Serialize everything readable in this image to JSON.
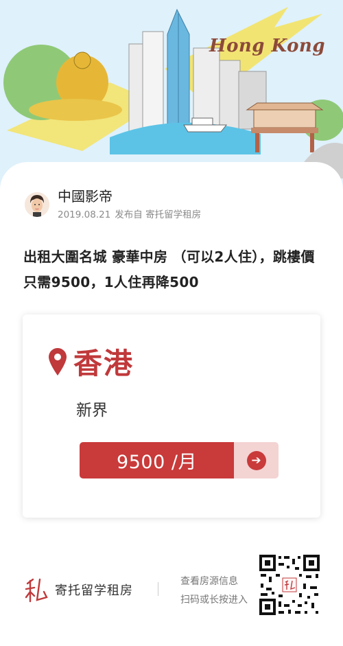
{
  "hero": {
    "title": "Hong Kong"
  },
  "author": {
    "name": "中國影帝",
    "date": "2019.08.21",
    "publish_from": "发布自 寄托留学租房"
  },
  "post": {
    "title": "出租大圍名城  豪華中房 （可以2人住），跳樓價只需9500，1人住再降500"
  },
  "listing": {
    "city": "香港",
    "district": "新界",
    "price": "9500 /月",
    "go_icon": "arrow-right-icon"
  },
  "footer": {
    "brand_name": "寄托留学租房",
    "qr_line1": "查看房源信息",
    "qr_line2": "扫码或长按进入"
  },
  "colors": {
    "accent": "#c93a3a",
    "accent_light": "#f4d3d3",
    "hero_sky": "#dff1fb"
  }
}
